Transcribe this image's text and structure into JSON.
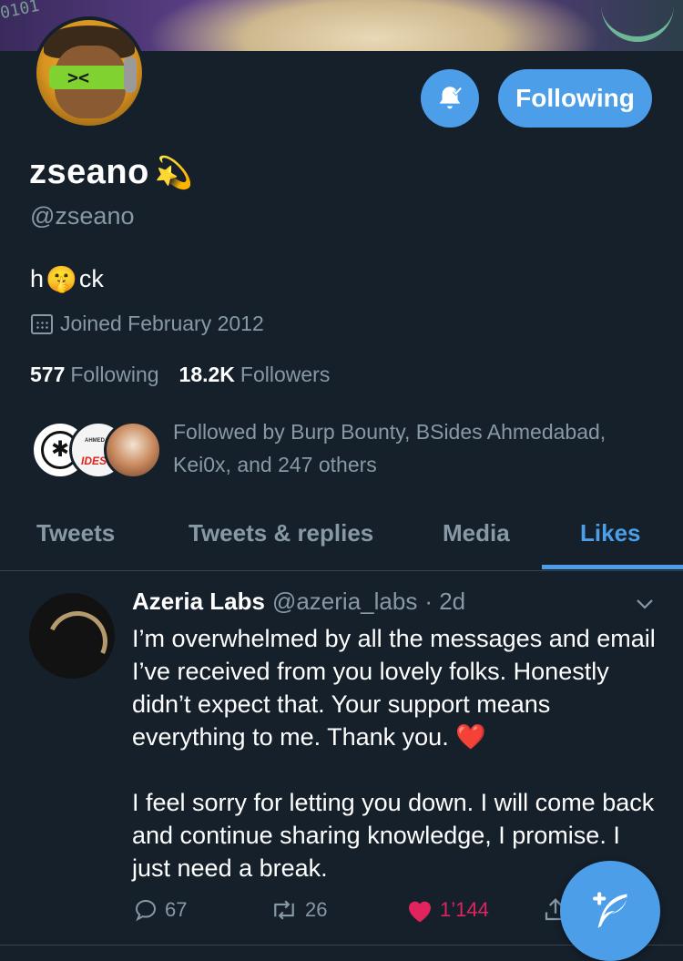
{
  "colors": {
    "background": "#15202b",
    "accent": "#4c9ee8",
    "muted": "#8899a6",
    "like": "#e0245e",
    "divider": "#38444d"
  },
  "banner": {
    "digits": "0101"
  },
  "profile": {
    "name": "zseano",
    "name_emoji": "💫",
    "handle": "@zseano",
    "bio_before": "h",
    "bio_emoji": "🤫",
    "bio_after": "ck",
    "joined": "Joined February 2012",
    "following_count": "577",
    "following_label": "Following",
    "followers_count": "18.2K",
    "followers_label": "Followers",
    "followed_by": "Followed by Burp Bounty, BSides Ahmedabad, Kei0x, and 247 others",
    "followed_avatar_labels": {
      "bsides_top": "AHMEDABAD",
      "bsides_main": "IDES"
    }
  },
  "actions": {
    "notifications_icon": "bell-check-icon",
    "follow_label": "Following"
  },
  "tabs": [
    {
      "label": "Tweets",
      "active": false
    },
    {
      "label": "Tweets & replies",
      "active": false
    },
    {
      "label": "Media",
      "active": false
    },
    {
      "label": "Likes",
      "active": true
    }
  ],
  "tweet": {
    "author_name": "Azeria Labs",
    "author_handle": "@azeria_labs",
    "time": "· 2d",
    "text_1": "I’m overwhelmed by all the messages and email I’ve received from you lovely folks. Honestly didn’t expect that. Your support means everything to me. Thank you. ",
    "text_1_emoji": "❤️",
    "text_2": "I feel sorry for letting you down. I will come back and continue sharing knowledge, I promise. I just need a break.",
    "replies": "67",
    "retweets": "26",
    "likes": "1’144",
    "liked": true
  },
  "compose_icon": "compose-feather-icon"
}
